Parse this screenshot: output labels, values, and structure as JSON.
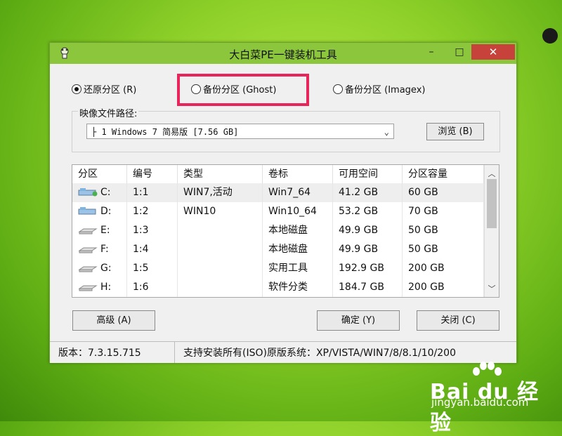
{
  "window": {
    "title": "大白菜PE一键装机工具",
    "minimize": "–",
    "maximize": "□",
    "close": "✕"
  },
  "options": {
    "restore": "还原分区 (R)",
    "backup_ghost": "备份分区 (Ghost)",
    "backup_imagex": "备份分区 (Imagex)",
    "selected": "restore"
  },
  "image": {
    "label": "映像文件路径:",
    "value": "├ 1 Windows 7 简易版 [7.56 GB]",
    "browse": "浏览 (B)"
  },
  "table": {
    "columns": [
      "分区",
      "编号",
      "类型",
      "卷标",
      "可用空间",
      "分区容量"
    ],
    "rows": [
      [
        "C:",
        "1:1",
        "WIN7,活动",
        "Win7_64",
        "41.2 GB",
        "60 GB"
      ],
      [
        "D:",
        "1:2",
        "WIN10",
        "Win10_64",
        "53.2 GB",
        "70 GB"
      ],
      [
        "E:",
        "1:3",
        "",
        "本地磁盘",
        "49.9 GB",
        "50 GB"
      ],
      [
        "F:",
        "1:4",
        "",
        "本地磁盘",
        "49.9 GB",
        "50 GB"
      ],
      [
        "G:",
        "1:5",
        "",
        "实用工具",
        "192.9 GB",
        "200 GB"
      ],
      [
        "H:",
        "1:6",
        "",
        "软件分类",
        "184.7 GB",
        "200 GB"
      ]
    ]
  },
  "buttons": {
    "advanced": "高级 (A)",
    "ok": "确定 (Y)",
    "cancel": "关闭 (C)"
  },
  "status": {
    "version": "版本：7.3.15.715",
    "info": "支持安装所有(ISO)原版系统：XP/VISTA/WIN7/8/8.1/10/200"
  },
  "watermark": {
    "brand": "Bai du 经验",
    "url": "jingyan.baidu.com"
  },
  "colors": {
    "titlebar": "#8cc63c",
    "close": "#c7423a",
    "highlight": "#e8245a"
  }
}
